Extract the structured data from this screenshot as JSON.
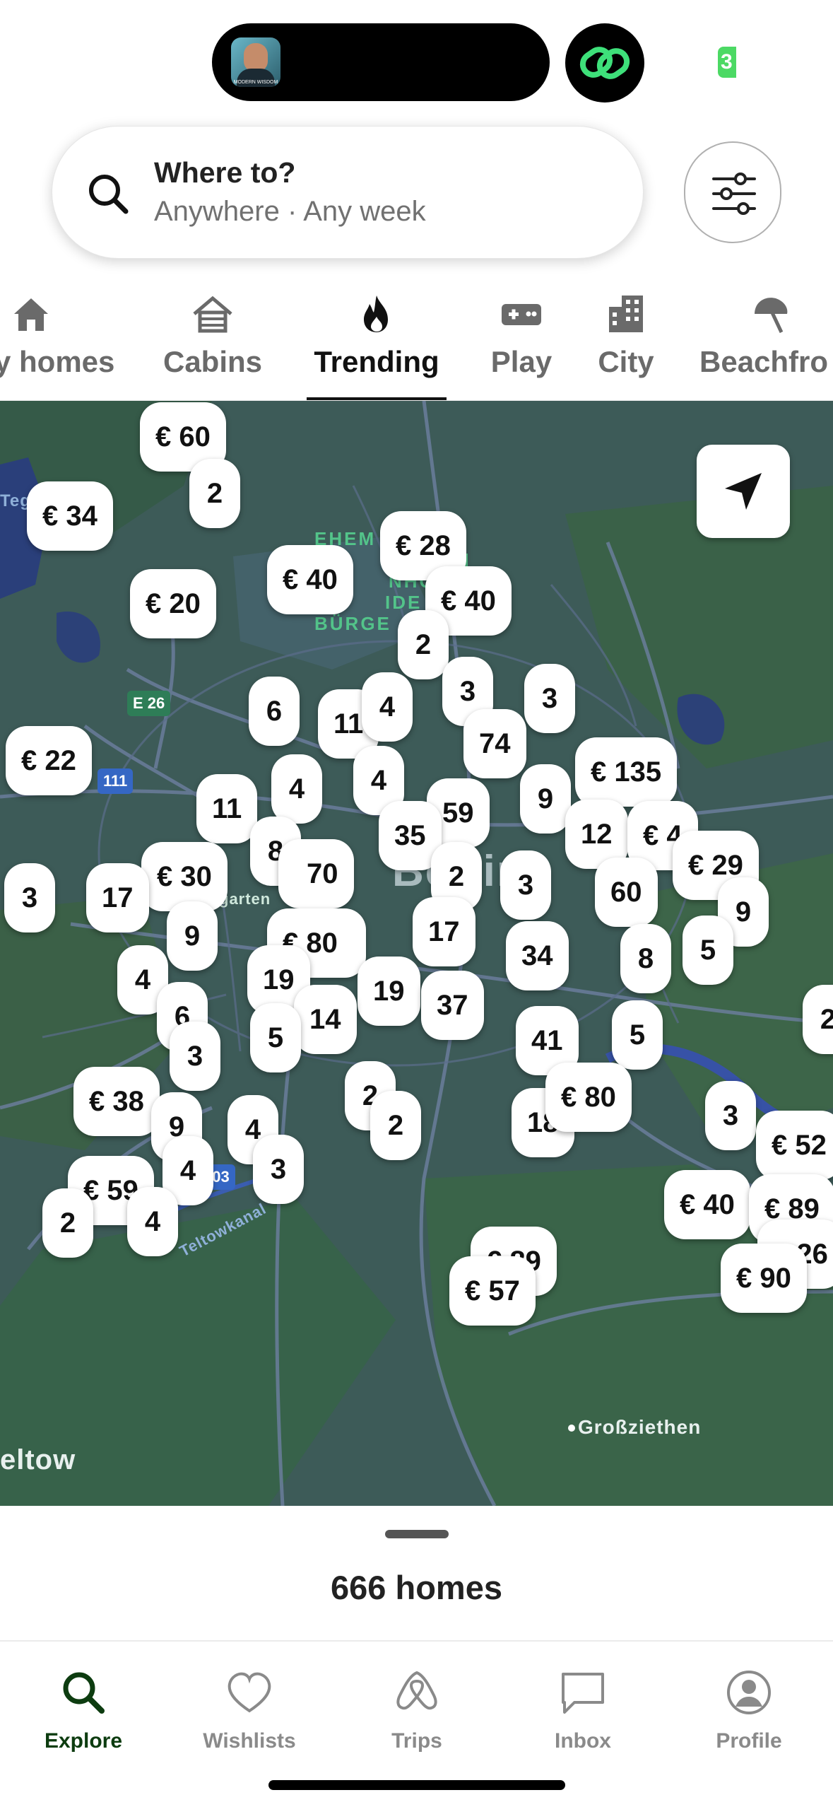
{
  "status_bar": {
    "thumbnail_caption": "MODERN WISDOM",
    "badge": "3",
    "accent": "#4cd964"
  },
  "search": {
    "title": "Where to?",
    "subtitle": "Anywhere · Any week",
    "icon": "search-icon"
  },
  "filters": {
    "icon": "sliders-icon"
  },
  "categories": [
    {
      "label": "y homes",
      "icon": "home-icon"
    },
    {
      "label": "Cabins",
      "icon": "cabin-icon"
    },
    {
      "label": "Trending",
      "icon": "flame-icon",
      "active": true
    },
    {
      "label": "Play",
      "icon": "gamepad-icon"
    },
    {
      "label": "City",
      "icon": "building-icon"
    },
    {
      "label": "Beachfro",
      "icon": "beach-umbrella-icon"
    }
  ],
  "map": {
    "city_label": "Berlin",
    "place_labels": [
      "Großziethen",
      "eltow",
      "Teg",
      "Teltowkanal",
      "garten"
    ],
    "district_label": [
      "EHEM",
      "N",
      "NHO",
      "IDE",
      "BÜRGE"
    ],
    "route_shields": [
      "E 26",
      "111",
      "103",
      "111"
    ],
    "pins": [
      "€ 60",
      "2",
      "€ 34",
      "€ 28",
      "€ 40",
      "€ 40",
      "€ 20",
      "2",
      "6",
      "11",
      "4",
      "3",
      "3",
      "€ 22",
      "74",
      "€ 135",
      "11",
      "4",
      "4",
      "59",
      "9",
      "35",
      "12",
      "€ 4",
      "€ 29",
      "8",
      "€ 30",
      "70",
      "2",
      "3",
      "3",
      "17",
      "60",
      "9",
      "9",
      "€ 80",
      "17",
      "34",
      "8",
      "5",
      "4",
      "19",
      "19",
      "37",
      "6",
      "14",
      "5",
      "41",
      "5",
      "3",
      "2",
      "€ 38",
      "18",
      "€ 80",
      "9",
      "4",
      "2",
      "3",
      "4",
      "€ 59",
      "3",
      "€ 52",
      "2",
      "4",
      "€ 40",
      "€ 89",
      "€ 26",
      "€ 89",
      "€ 90",
      "€ 57",
      "2"
    ]
  },
  "sheet": {
    "count_label": "666 homes"
  },
  "tab_bar": [
    {
      "label": "Explore",
      "icon": "search-icon",
      "active": true
    },
    {
      "label": "Wishlists",
      "icon": "heart-icon"
    },
    {
      "label": "Trips",
      "icon": "airbnb-logo-icon"
    },
    {
      "label": "Inbox",
      "icon": "message-icon"
    },
    {
      "label": "Profile",
      "icon": "user-icon"
    }
  ],
  "colors": {
    "active_tab": "#0d3c10",
    "map_base": "#3c5a58",
    "district": "#53c48a"
  }
}
